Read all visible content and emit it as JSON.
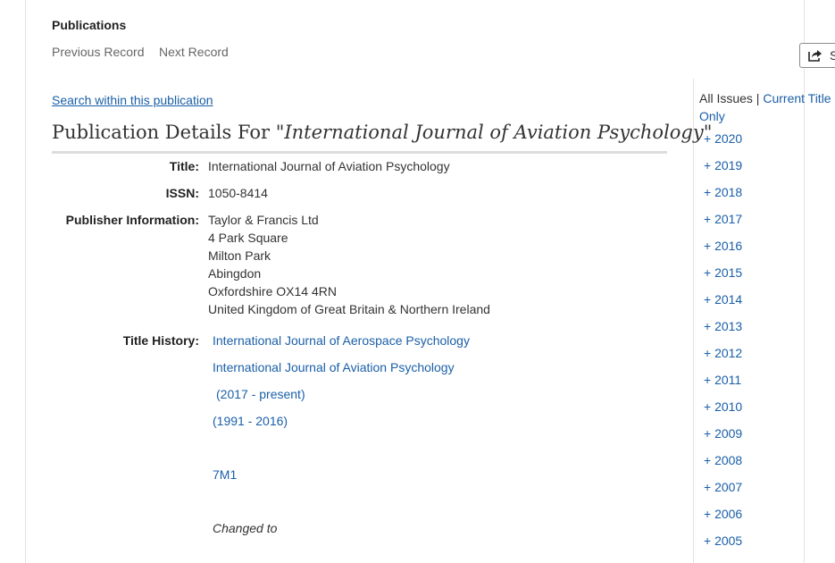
{
  "header": {
    "section_title": "Publications",
    "prev_label": "Previous Record",
    "next_label": "Next Record",
    "share_label": "S"
  },
  "search_within": "Search within this publication",
  "details": {
    "heading_prefix": "Publication Details For ",
    "heading_title": "\"International Journal of Aviation Psychology\"",
    "title_label": "Title:",
    "title_value": "International Journal of Aviation Psychology",
    "issn_label": "ISSN:",
    "issn_value": "1050-8414",
    "publisher_label": "Publisher Information:",
    "publisher_lines": [
      "Taylor & Francis Ltd",
      "4 Park Square",
      "Milton Park",
      "Abingdon",
      "Oxfordshire OX14 4RN",
      "United Kingdom of Great Britain & Northern Ireland"
    ],
    "history_label": "Title History:",
    "history": {
      "link_1": "International Journal of Aerospace Psychology",
      "link_2": "International Journal of Aviation Psychology",
      "range_1": "(2017 - present)",
      "range_2": "(1991 - 2016)",
      "code": "7M1",
      "changed_to": "Changed to"
    }
  },
  "issues": {
    "all_issues": "All Issues",
    "separator": " | ",
    "current_title_only": "Current Title Only",
    "years": [
      "+ 2020",
      "+ 2019",
      "+ 2018",
      "+ 2017",
      "+ 2016",
      "+ 2015",
      "+ 2014",
      "+ 2013",
      "+ 2012",
      "+ 2011",
      "+ 2010",
      "+ 2009",
      "+ 2008",
      "+ 2007",
      "+ 2006",
      "+ 2005"
    ]
  }
}
